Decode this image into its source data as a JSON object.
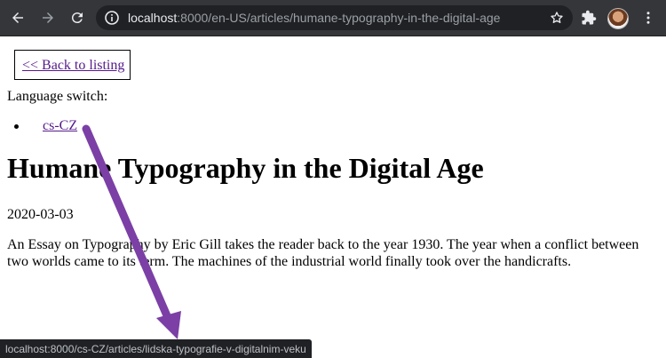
{
  "browser": {
    "url_host": "localhost",
    "url_rest": ":8000/en-US/articles/humane-typography-in-the-digital-age",
    "status_url": "localhost:8000/cs-CZ/articles/lidska-typografie-v-digitalnim-veku"
  },
  "page": {
    "back_link": "<< Back to listing",
    "language_label": "Language switch:",
    "languages": [
      {
        "label": "cs-CZ"
      }
    ],
    "title": "Humane Typography in the Digital Age",
    "date": "2020-03-03",
    "body": "An Essay on Typography by Eric Gill takes the reader back to the year 1930. The year when a conflict between two worlds came to its term. The machines of the industrial world finally took over the handicrafts."
  },
  "colors": {
    "chrome": "#35363a",
    "omnibox": "#202124",
    "link_visited": "#551a8b",
    "arrow": "#7b3fa6"
  }
}
